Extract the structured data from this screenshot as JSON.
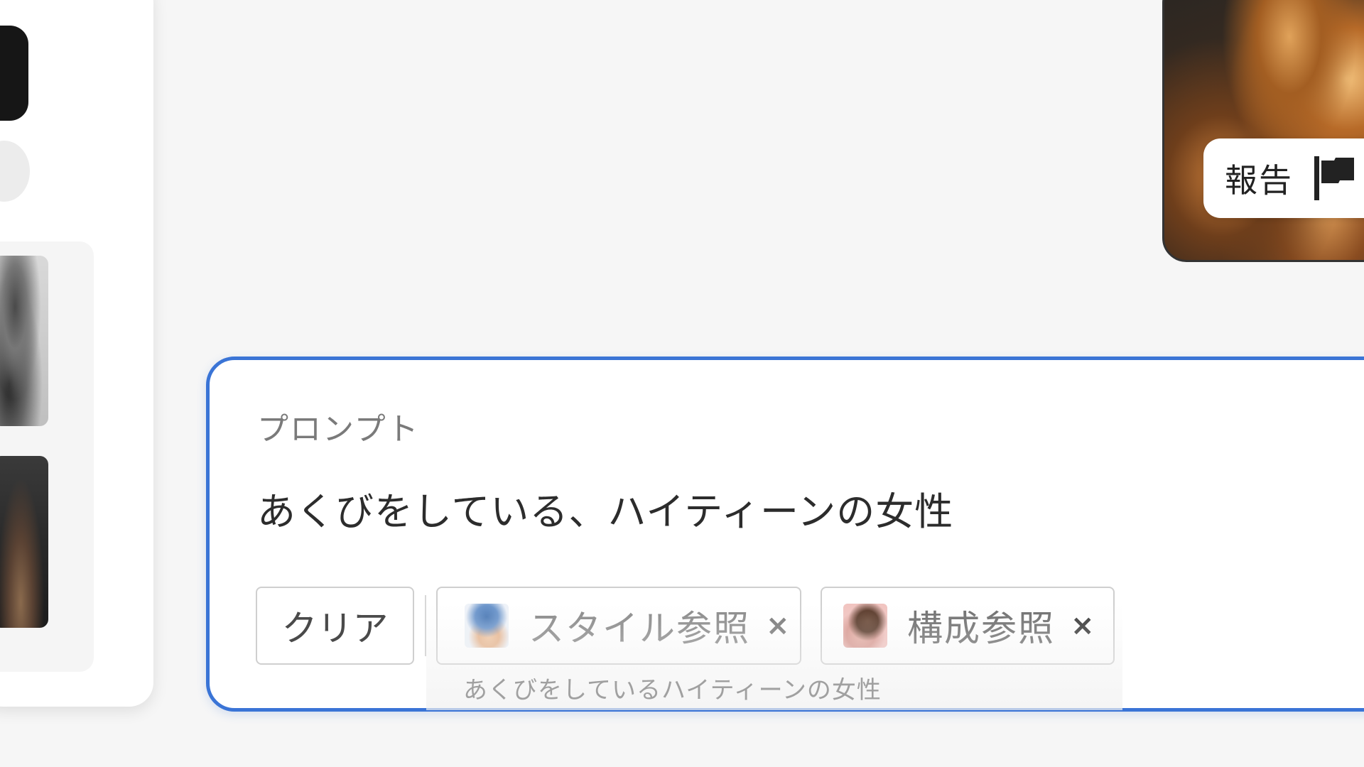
{
  "report": {
    "label": "報告",
    "icon": "flag-icon"
  },
  "prompt": {
    "label": "プロンプト",
    "text": "あくびをしている、ハイティーンの女性"
  },
  "controls": {
    "clear_label": "クリア",
    "style_ref": {
      "label": "スタイル参照",
      "close": "×",
      "icon": "style-reference-thumbnail"
    },
    "composition_ref": {
      "label": "構成参照",
      "close": "×",
      "icon": "composition-reference-thumbnail"
    }
  },
  "tooltip": {
    "text": "あくびをしているハイティーンの女性"
  },
  "colors": {
    "accent": "#3a74d6",
    "background": "#f6f6f6"
  }
}
